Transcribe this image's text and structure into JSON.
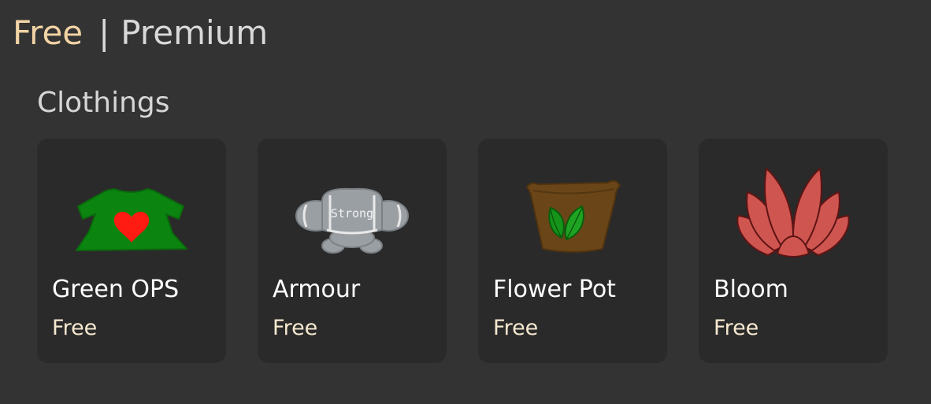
{
  "tabs": {
    "free_label": "Free",
    "separator": "|",
    "premium_label": "Premium"
  },
  "section": {
    "title": "Clothings"
  },
  "items": [
    {
      "name": "Green OPS",
      "price": "Free",
      "icon": "green-shirt-heart-icon",
      "image_text": ""
    },
    {
      "name": "Armour",
      "price": "Free",
      "icon": "armour-icon",
      "image_text": "Strong"
    },
    {
      "name": "Flower Pot",
      "price": "Free",
      "icon": "flower-pot-icon",
      "image_text": ""
    },
    {
      "name": "Bloom",
      "price": "Free",
      "icon": "bloom-flower-icon",
      "image_text": ""
    }
  ],
  "colors": {
    "background": "#333333",
    "card": "#2a2a2a",
    "active_tab": "#f2d3a5",
    "price": "#f5e8cf"
  }
}
